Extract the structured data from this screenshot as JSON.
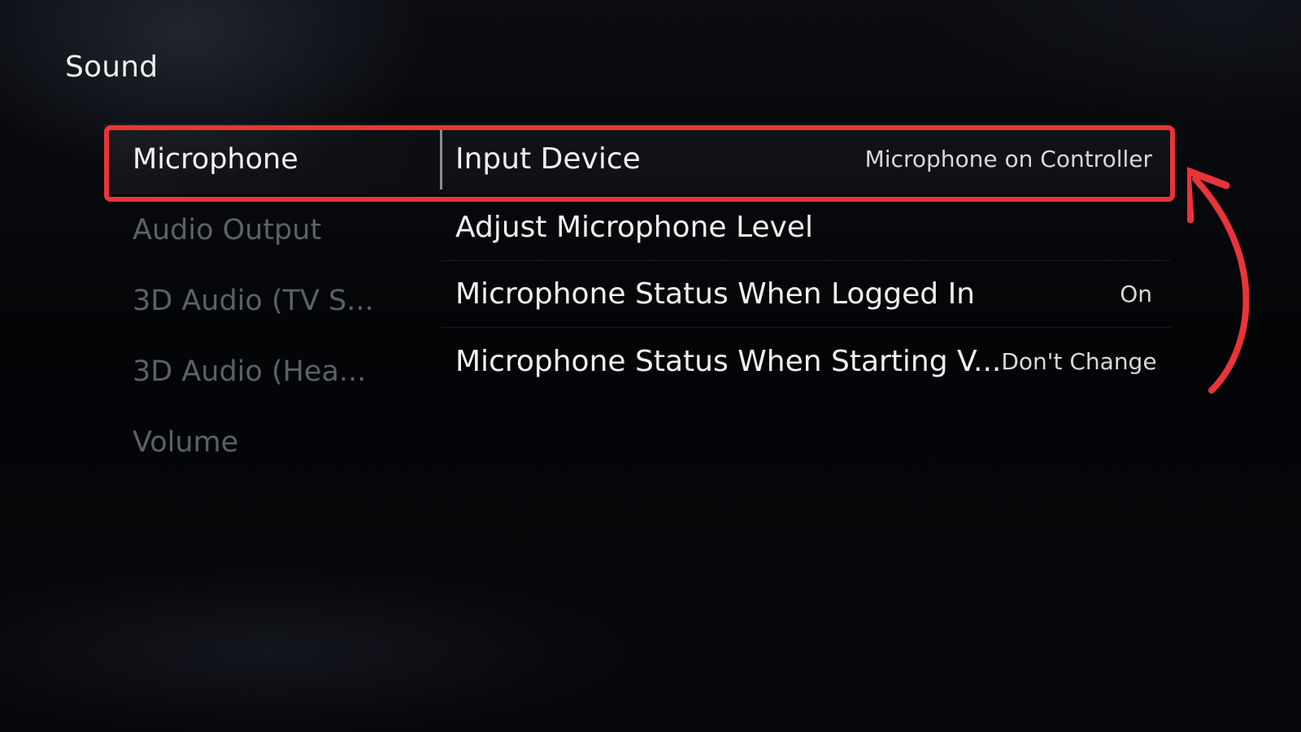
{
  "page": {
    "title": "Sound"
  },
  "sidebar": {
    "items": [
      {
        "label": "Microphone",
        "selected": true
      },
      {
        "label": "Audio Output",
        "selected": false
      },
      {
        "label": "3D Audio (TV S...",
        "selected": false
      },
      {
        "label": "3D Audio (Hea...",
        "selected": false
      },
      {
        "label": "Volume",
        "selected": false
      }
    ]
  },
  "settings": {
    "items": [
      {
        "label": "Input Device",
        "value": "Microphone on Controller"
      },
      {
        "label": "Adjust Microphone Level",
        "value": ""
      },
      {
        "label": "Microphone Status When Logged In",
        "value": "On"
      },
      {
        "label": "Microphone Status When Starting V...",
        "value": "Don't Change"
      }
    ]
  },
  "annotation": {
    "highlight_color": "#e8343b",
    "arrow_color": "#e8343b",
    "arrow_icon": "curved-arrow-icon"
  },
  "colors": {
    "background": "#050608",
    "text_primary": "#f0f0f0",
    "text_dim": "#5c6068"
  }
}
